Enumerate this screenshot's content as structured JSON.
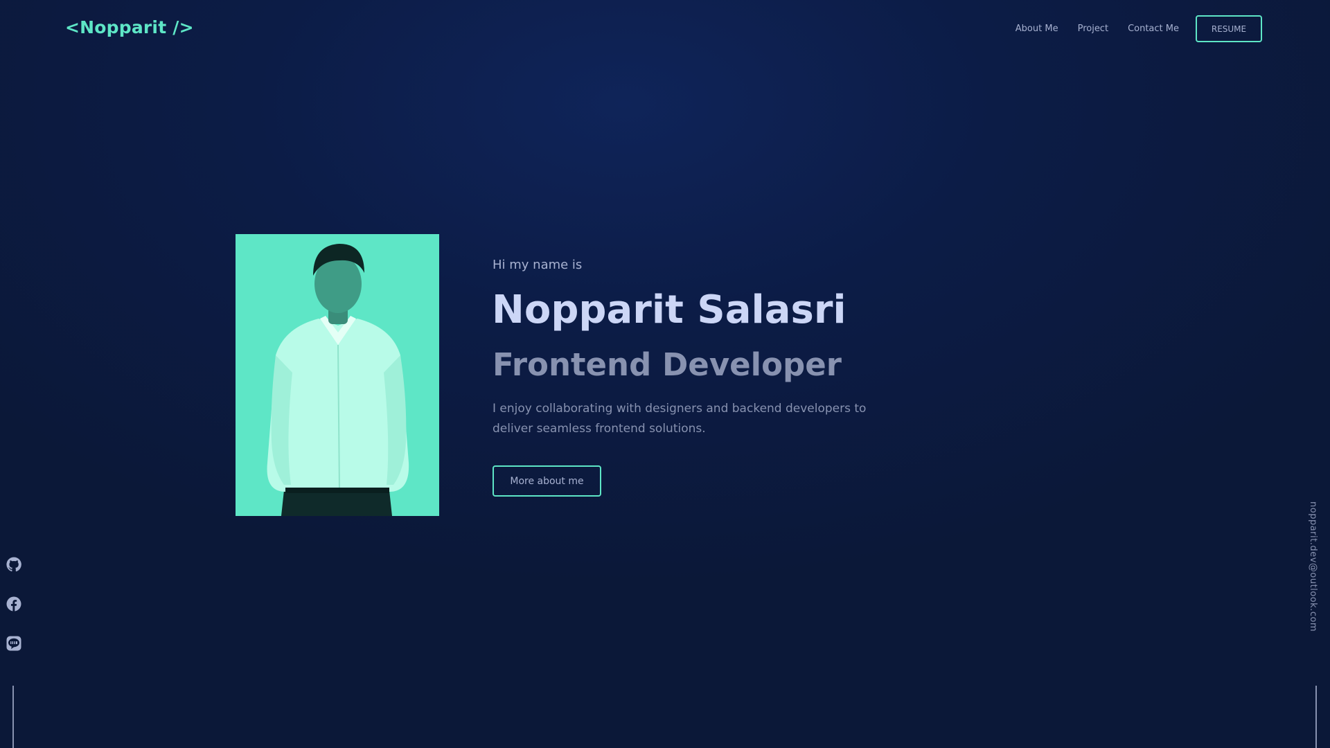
{
  "header": {
    "logo": "<Nopparit />",
    "nav": [
      "About Me",
      "Project",
      "Contact Me"
    ],
    "resume_label": "RESUME"
  },
  "hero": {
    "greeting": "Hi my name is",
    "name": "Nopparit Salasri",
    "role": "Frontend Developer",
    "description": "I enjoy collaborating with designers and backend developers to deliver seamless frontend solutions.",
    "more_label": "More about me"
  },
  "social": {
    "icons": [
      "github-icon",
      "facebook-icon",
      "line-icon"
    ]
  },
  "contact": {
    "email": "nopparit.dev@outlook.com"
  },
  "colors": {
    "accent": "#5ee6c6",
    "background": "#0b1838",
    "heading": "#ccd6f6",
    "muted": "#8892b0"
  }
}
